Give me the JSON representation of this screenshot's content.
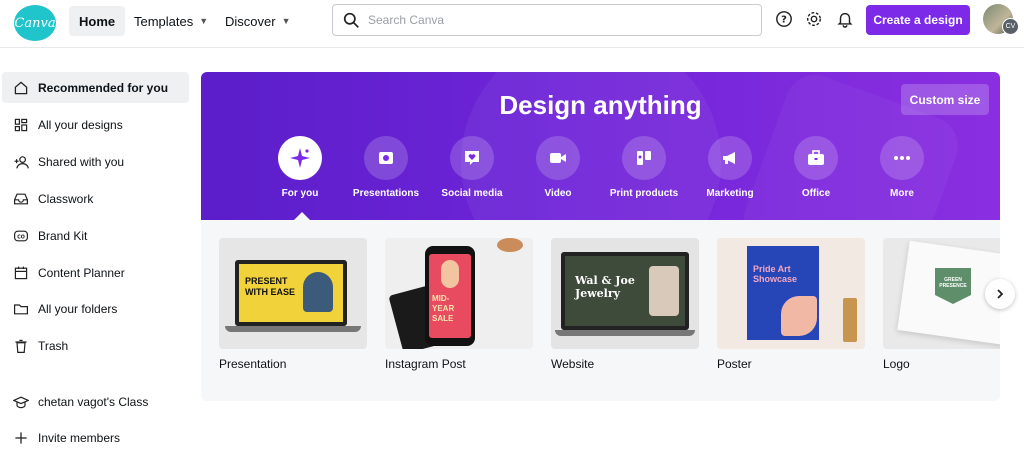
{
  "app": {
    "logo_text": "Canva",
    "accent": "#7d2ae8",
    "logo_color": "#20c4cb"
  },
  "nav": {
    "home": "Home",
    "templates": "Templates",
    "discover": "Discover"
  },
  "search": {
    "placeholder": "Search Canva",
    "icon": "search-icon"
  },
  "toolbar": {
    "help_icon": "help-icon",
    "settings_icon": "gear-icon",
    "notifications_icon": "bell-icon",
    "create_label": "Create a design",
    "avatar_initials": "CV"
  },
  "sidebar": {
    "items": [
      {
        "label": "Recommended for you",
        "icon": "home-icon",
        "active": true
      },
      {
        "label": "All your designs",
        "icon": "grid-icon"
      },
      {
        "label": "Shared with you",
        "icon": "users-icon"
      },
      {
        "label": "Classwork",
        "icon": "inbox-icon"
      },
      {
        "label": "Brand Kit",
        "icon": "brand-kit-icon"
      },
      {
        "label": "Content Planner",
        "icon": "calendar-icon"
      },
      {
        "label": "All your folders",
        "icon": "folder-icon"
      },
      {
        "label": "Trash",
        "icon": "trash-icon"
      }
    ],
    "class_name": "chetan vagot's Class",
    "invite": "Invite members"
  },
  "banner": {
    "title": "Design anything",
    "custom_size": "Custom size",
    "categories": [
      {
        "label": "For you",
        "icon": "sparkle-icon",
        "active": true
      },
      {
        "label": "Presentations",
        "icon": "presentation-icon"
      },
      {
        "label": "Social media",
        "icon": "heart-message-icon"
      },
      {
        "label": "Video",
        "icon": "video-camera-icon"
      },
      {
        "label": "Print products",
        "icon": "print-icon"
      },
      {
        "label": "Marketing",
        "icon": "megaphone-icon"
      },
      {
        "label": "Office",
        "icon": "briefcase-icon"
      },
      {
        "label": "More",
        "icon": "more-dots-icon"
      }
    ]
  },
  "templates": {
    "cards": [
      {
        "label": "Presentation",
        "thumb_text": [
          "PRESENT",
          "WITH EASE"
        ]
      },
      {
        "label": "Instagram Post",
        "thumb_text": [
          "MID-YEAR",
          "SALE"
        ]
      },
      {
        "label": "Website",
        "thumb_text": [
          "Wal & Joe",
          "Jewelry"
        ]
      },
      {
        "label": "Poster",
        "thumb_text": [
          "Pride Art",
          "Showcase"
        ]
      },
      {
        "label": "Logo",
        "thumb_text": [
          "GREEN",
          "PRESENCE"
        ]
      }
    ]
  }
}
